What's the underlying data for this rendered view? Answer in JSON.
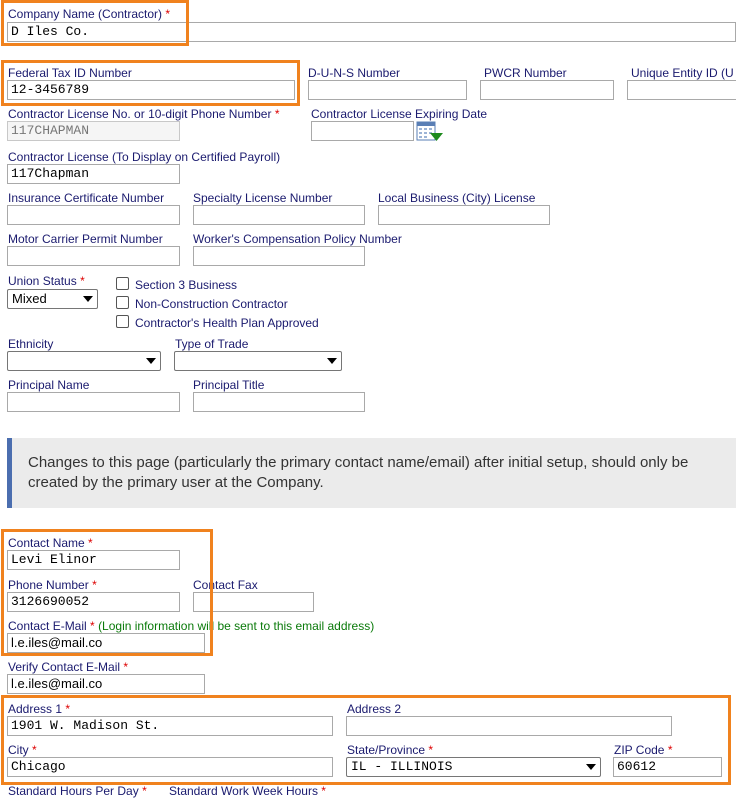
{
  "company": {
    "name_label": "Company Name (Contractor)",
    "name_value": "D Iles Co."
  },
  "tax": {
    "federal_tax_label": "Federal Tax ID Number",
    "federal_tax_value": "12-3456789",
    "duns_label": "D-U-N-S Number",
    "duns_value": "",
    "pwcr_label": "PWCR Number",
    "pwcr_value": "",
    "uei_label": "Unique Entity ID (U",
    "uei_value": ""
  },
  "license": {
    "contractor_license_label": "Contractor License No. or 10-digit Phone Number",
    "contractor_license_value": "117CHAPMAN",
    "expiring_label": "Contractor License Expiring Date",
    "expiring_value": "",
    "display_label": "Contractor License (To Display on Certified Payroll)",
    "display_value": "117Chapman",
    "insurance_label": "Insurance Certificate Number",
    "specialty_label": "Specialty License Number",
    "local_business_label": "Local Business (City) License",
    "motor_carrier_label": "Motor Carrier Permit Number",
    "workers_comp_label": "Worker's Compensation Policy Number"
  },
  "union": {
    "label": "Union Status",
    "value": "Mixed",
    "section3_label": "Section 3 Business",
    "nonconstruction_label": "Non-Construction Contractor",
    "health_plan_label": "Contractor's Health Plan Approved"
  },
  "demographics": {
    "ethnicity_label": "Ethnicity",
    "ethnicity_value": "",
    "trade_label": "Type of Trade",
    "trade_value": "",
    "principal_name_label": "Principal Name",
    "principal_title_label": "Principal Title"
  },
  "notice": {
    "line1": "Changes to this page (particularly the primary contact name/email) after initial setup, should only be",
    "line2": "created by the primary user at the Company."
  },
  "contact": {
    "name_label": "Contact Name",
    "name_value": "Levi Elinor",
    "phone_label": "Phone Number",
    "phone_value": "3126690052",
    "fax_label": "Contact Fax",
    "fax_value": "",
    "email_label": "Contact E-Mail",
    "email_note": "(Login information will be sent to this email address)",
    "email_value": "l.e.iles@mail.co",
    "verify_label": "Verify Contact E-Mail",
    "verify_value": "l.e.iles@mail.co"
  },
  "address": {
    "address1_label": "Address 1",
    "address1_value": "1901 W. Madison St.",
    "address2_label": "Address 2",
    "address2_value": "",
    "city_label": "City",
    "city_value": "Chicago",
    "state_label": "State/Province",
    "state_value": "IL - ILLINOIS",
    "zip_label": "ZIP Code",
    "zip_value": "60612"
  },
  "hours": {
    "per_day_label": "Standard Hours Per Day",
    "per_week_label": "Standard Work Week Hours"
  },
  "required_marker": "*",
  "colors": {
    "highlight": "#f0821e",
    "label": "#1a1a6e",
    "required": "#dd0000",
    "notice_bar": "#4b6eaf",
    "notice_bg": "#ebebeb"
  }
}
